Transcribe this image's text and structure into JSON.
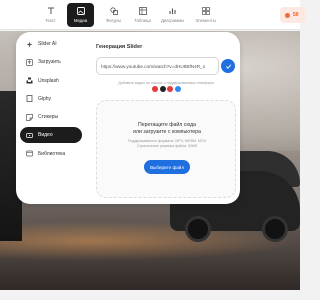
{
  "toolbar": {
    "tools": [
      {
        "label": "Текст",
        "icon": "text-icon"
      },
      {
        "label": "Медиа",
        "icon": "media-icon"
      },
      {
        "label": "Фигуры",
        "icon": "shapes-icon"
      },
      {
        "label": "Таблица",
        "icon": "table-icon"
      },
      {
        "label": "Диаграммы",
        "icon": "chart-icon"
      },
      {
        "label": "Элементы",
        "icon": "elements-icon"
      }
    ],
    "active_tool": "Медиа",
    "right_button_text": "50"
  },
  "menu": {
    "items": [
      {
        "label": "Slider AI",
        "icon": "ai-sparkle-icon"
      },
      {
        "label": "Загрузить",
        "icon": "upload-icon"
      },
      {
        "label": "Unsplash",
        "icon": "unsplash-icon"
      },
      {
        "label": "Giphy",
        "icon": "giphy-icon"
      },
      {
        "label": "Стикеры",
        "icon": "sticker-icon"
      },
      {
        "label": "Видео",
        "icon": "video-icon"
      },
      {
        "label": "Библиотека",
        "icon": "library-icon"
      }
    ],
    "active_item": "Видео"
  },
  "content": {
    "title": "Генерация Slider",
    "url_value": "https://www.youtube.com/watch?v=dHU8BfN4R_s",
    "hint": "Добавьте видео по ссылке с поддерживаемых платформ",
    "platforms": [
      "youtube-icon",
      "vimeo-icon",
      "rutube-icon",
      "vk-video-icon"
    ],
    "dropzone": {
      "line1": "Перетащите файл сюда",
      "line2": "или загрузите с компьютера",
      "formats": "Поддерживаются форматы: MP4, WEBM, MOV",
      "limit": "Ограничение размера файла: 50Мб",
      "button": "Выберите файл"
    }
  },
  "colors": {
    "accent": "#1f6fe0",
    "active_dark": "#1c1c1c",
    "orange": "#f26b3a"
  }
}
